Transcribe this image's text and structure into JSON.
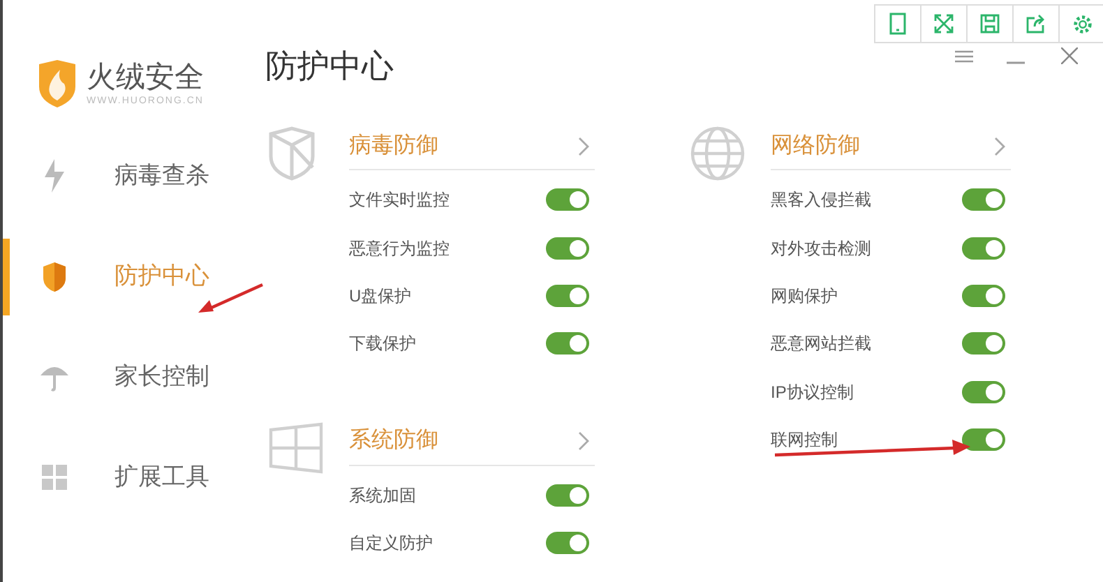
{
  "app": {
    "name": "火绒安全",
    "url": "WWW.HUORONG.CN"
  },
  "page_title": "防护中心",
  "sidebar": [
    {
      "label": "病毒查杀",
      "selected": false
    },
    {
      "label": "防护中心",
      "selected": true
    },
    {
      "label": "家长控制",
      "selected": false
    },
    {
      "label": "扩展工具",
      "selected": false
    }
  ],
  "sections": [
    {
      "title": "病毒防御",
      "items": [
        {
          "label": "文件实时监控",
          "on": true
        },
        {
          "label": "恶意行为监控",
          "on": true
        },
        {
          "label": "U盘保护",
          "on": true
        },
        {
          "label": "下载保护",
          "on": true
        }
      ]
    },
    {
      "title": "网络防御",
      "items": [
        {
          "label": "黑客入侵拦截",
          "on": true
        },
        {
          "label": "对外攻击检测",
          "on": true
        },
        {
          "label": "网购保护",
          "on": true
        },
        {
          "label": "恶意网站拦截",
          "on": true
        },
        {
          "label": "IP协议控制",
          "on": true
        },
        {
          "label": "联网控制",
          "on": true
        }
      ]
    },
    {
      "title": "系统防御",
      "items": [
        {
          "label": "系统加固",
          "on": true
        },
        {
          "label": "自定义防护",
          "on": true
        }
      ]
    }
  ]
}
